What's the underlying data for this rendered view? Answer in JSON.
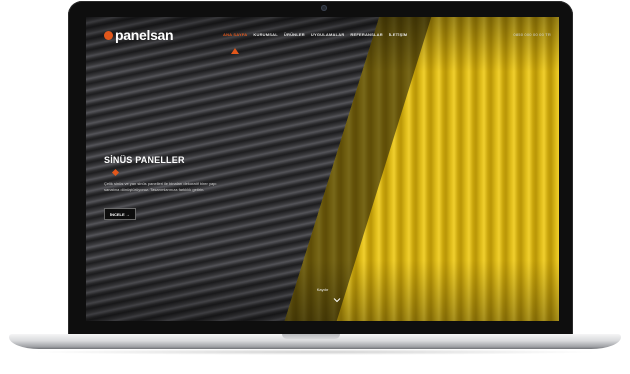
{
  "site": {
    "logo_text": "panelsan",
    "brand_color": "#e2571b"
  },
  "nav": {
    "items": [
      {
        "label": "ANA SAYFA",
        "active": true
      },
      {
        "label": "KURUMSAL",
        "active": false
      },
      {
        "label": "ÜRÜNLER",
        "active": false
      },
      {
        "label": "UYGULAMALAR",
        "active": false
      },
      {
        "label": "REFERANSLAR",
        "active": false
      },
      {
        "label": "İLETİŞİM",
        "active": false
      }
    ],
    "contact_text": "0850 000 00 00   TR"
  },
  "hero": {
    "title": "SİNÜS PANELLER",
    "description": "Çelik sinüs ve yan sinüs panelleri ile binaları dekoratif birer yapı sanatına dönüştürüyoruz. Tasarımlarınıza farklılık getirin.",
    "button_label": "İNCELE  →"
  },
  "scroll": {
    "label": "Kaydır",
    "icon": "chevron-down-icon"
  }
}
